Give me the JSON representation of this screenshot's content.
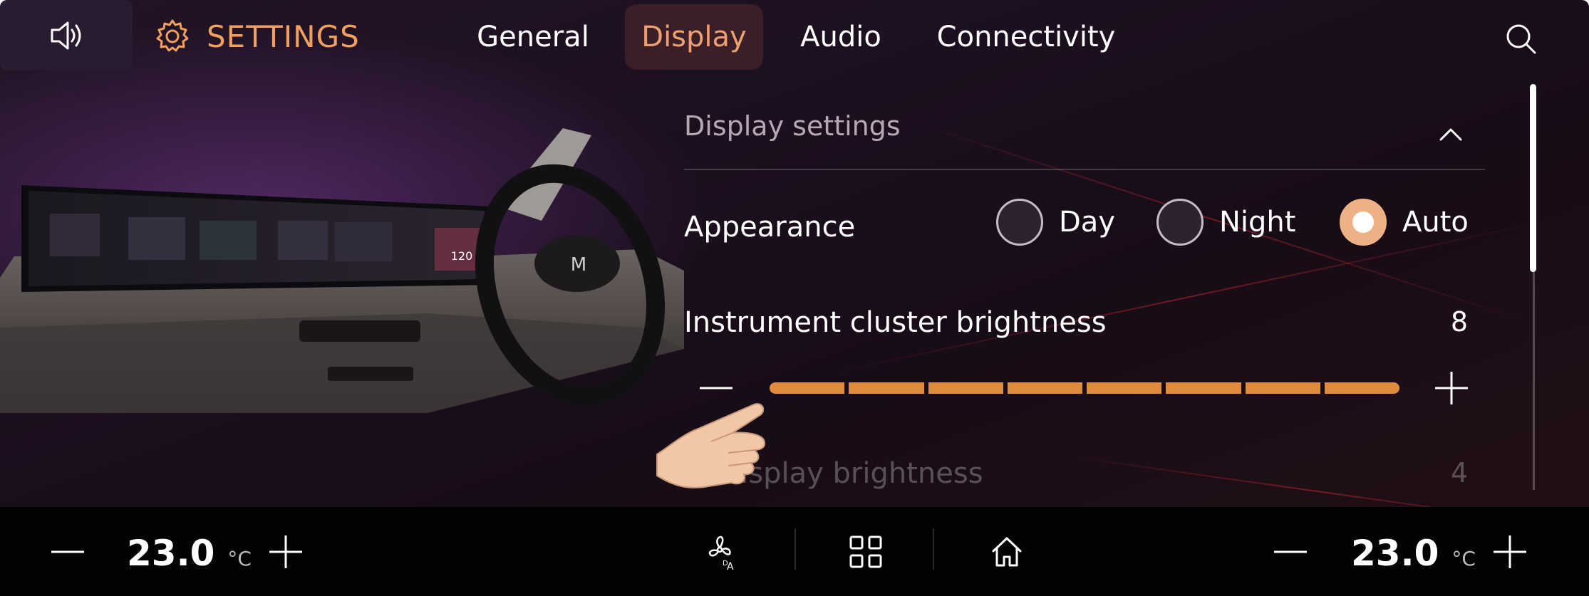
{
  "header": {
    "title": "SETTINGS",
    "tabs": [
      {
        "label": "General",
        "active": false
      },
      {
        "label": "Display",
        "active": true
      },
      {
        "label": "Audio",
        "active": false
      },
      {
        "label": "Connectivity",
        "active": false
      }
    ]
  },
  "panel": {
    "heading": "Display settings",
    "appearance": {
      "label": "Appearance",
      "options": [
        {
          "label": "Day",
          "selected": false
        },
        {
          "label": "Night",
          "selected": false
        },
        {
          "label": "Auto",
          "selected": true
        }
      ]
    },
    "cluster_brightness": {
      "label": "Instrument cluster brightness",
      "value": "8",
      "level": 8,
      "max": 8
    },
    "next_item": {
      "label": "er display brightness",
      "value": "4"
    }
  },
  "climate": {
    "left_temp": "23.0",
    "right_temp": "23.0",
    "unit": "°C"
  },
  "colors": {
    "accent": "#f0a060",
    "slider_fill": "#e08c3e",
    "radio_selected": "#eeb186"
  },
  "icons": [
    "volume-icon",
    "gear-icon",
    "search-icon",
    "chevron-up-icon",
    "minus-icon",
    "plus-icon",
    "fan-auto-icon",
    "apps-grid-icon",
    "home-icon"
  ]
}
